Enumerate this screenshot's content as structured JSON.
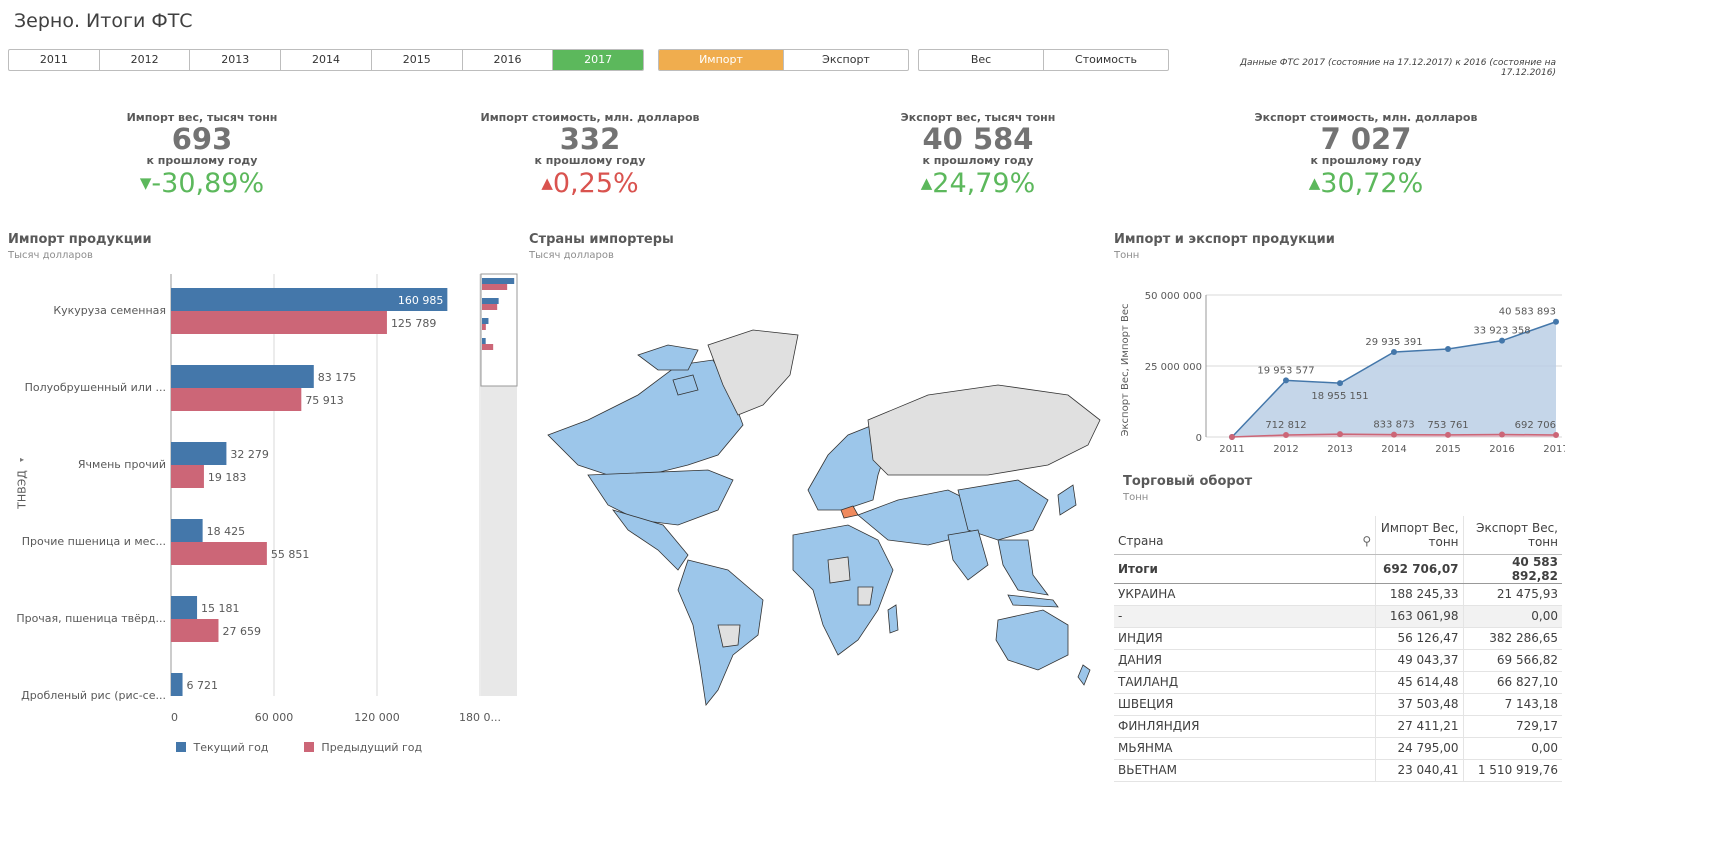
{
  "app_title": "Зерно. Итоги ФТС",
  "years": [
    "2011",
    "2012",
    "2013",
    "2014",
    "2015",
    "2016",
    "2017"
  ],
  "selected_year": "2017",
  "flow_toggle": [
    "Импорт",
    "Экспорт"
  ],
  "measure_toggle": [
    "Вес",
    "Стоимость"
  ],
  "source_note": "Данные ФТС 2017 (состояние на 17.12.2017) к 2016 (состояние на 17.12.2016)",
  "colors": {
    "green": "#5cb85c",
    "orange": "#f0ad4e",
    "blue": "#4477aa",
    "red": "#cc6677",
    "up": "#5cb85c",
    "down": "#d9534f"
  },
  "kpis": [
    {
      "label": "Импорт вес, тысяч тонн",
      "value": "693",
      "sub": "к прошлому году",
      "change": "-30,89%",
      "dir": "down",
      "color": "#5cb85c"
    },
    {
      "label": "Импорт стоимость, млн. долларов",
      "value": "332",
      "sub": "к прошлому году",
      "change": "0,25%",
      "dir": "up",
      "color": "#d9534f"
    },
    {
      "label": "Экспорт вес, тысяч тонн",
      "value": "40 584",
      "sub": "к прошлому году",
      "change": "24,79%",
      "dir": "up",
      "color": "#5cb85c"
    },
    {
      "label": "Экспорт стоимость, млн. долларов",
      "value": "7 027",
      "sub": "к прошлому году",
      "change": "30,72%",
      "dir": "up",
      "color": "#5cb85c"
    }
  ],
  "bar_panel": {
    "title": "Импорт продукции",
    "subtitle": "Тысяч долларов",
    "dim_label": "ТНВЭД",
    "legend_current": "Текущий год",
    "legend_prev": "Предыдущий год"
  },
  "map_panel": {
    "title": "Страны импортеры",
    "subtitle": "Тысяч долларов"
  },
  "line_panel": {
    "title": "Импорт и экспорт продукции",
    "subtitle": "Тонн"
  },
  "table_panel": {
    "title": "Торговый оборот",
    "subtitle": "Тонн",
    "col_country": "Страна",
    "col_import": "Импорт Вес, тонн",
    "col_export": "Экспорт Вес, тонн",
    "total": {
      "name": "Итоги",
      "imp": "692 706,07",
      "exp": "40 583 892,82"
    },
    "rows": [
      {
        "name": "УКРАИНА",
        "imp": "188 245,33",
        "exp": "21 475,93"
      },
      {
        "name": "-",
        "imp": "163 061,98",
        "exp": "0,00"
      },
      {
        "name": "ИНДИЯ",
        "imp": "56 126,47",
        "exp": "382 286,65"
      },
      {
        "name": "ДАНИЯ",
        "imp": "49 043,37",
        "exp": "69 566,82"
      },
      {
        "name": "ТАИЛАНД",
        "imp": "45 614,48",
        "exp": "66 827,10"
      },
      {
        "name": "ШВЕЦИЯ",
        "imp": "37 503,48",
        "exp": "7 143,18"
      },
      {
        "name": "ФИНЛЯНДИЯ",
        "imp": "27 411,21",
        "exp": "729,17"
      },
      {
        "name": "МЬЯНМА",
        "imp": "24 795,00",
        "exp": "0,00"
      },
      {
        "name": "ВЬЕТНАМ",
        "imp": "23 040,41",
        "exp": "1 510 919,76"
      }
    ]
  },
  "chart_data": [
    {
      "type": "bar",
      "title": "Импорт продукции",
      "categories": [
        "Кукуруза семенная",
        "Полуобрушенный или ...",
        "Ячмень прочий",
        "Прочие пшеница и мес...",
        "Прочая, пшеница твёрд...",
        "Дробленый рис (рис-се..."
      ],
      "series": [
        {
          "name": "Текущий год",
          "values": [
            160985,
            83175,
            32279,
            18425,
            15181,
            6721
          ],
          "labels": [
            "160 985",
            "83 175",
            "32 279",
            "18 425",
            "15 181",
            "6 721"
          ]
        },
        {
          "name": "Предыдущий год",
          "values": [
            125789,
            75913,
            19183,
            55851,
            27659,
            null
          ],
          "labels": [
            "125 789",
            "75 913",
            "19 183",
            "55 851",
            "27 659",
            ""
          ]
        }
      ],
      "x_ticks": [
        "0",
        "60 000",
        "120 000",
        "180 0..."
      ],
      "xlim": [
        0,
        180000
      ],
      "ylabel": "ТНВЭД"
    },
    {
      "type": "area",
      "title": "Импорт и экспорт продукции",
      "ylabel": "Экспорт Вес, Импорт Вес",
      "x": [
        "2011",
        "2012",
        "2013",
        "2014",
        "2015",
        "2016",
        "2017"
      ],
      "y_ticks": [
        "50 000 000",
        "25 000 000",
        "0"
      ],
      "ylim": [
        0,
        50000000
      ],
      "series": [
        {
          "name": "Экспорт Вес",
          "values": [
            0,
            19953577,
            18955151,
            29935391,
            31000000,
            33923358,
            40583893
          ],
          "labels": [
            "",
            "19 953 577",
            "18 955 151",
            "29 935 391",
            "",
            "33 923 358",
            "40 583 893"
          ]
        },
        {
          "name": "Импорт Вес",
          "values": [
            0,
            712812,
            1000000,
            833873,
            753761,
            900000,
            692706
          ],
          "labels": [
            "",
            "712 812",
            "",
            "833 873",
            "753 761",
            "",
            "692 706"
          ]
        }
      ]
    }
  ]
}
